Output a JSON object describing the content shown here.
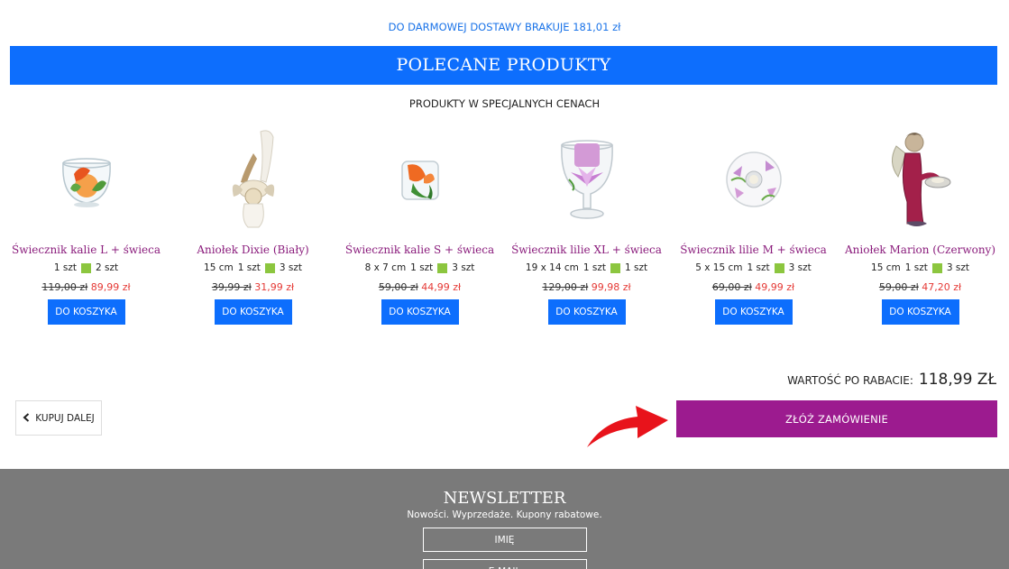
{
  "free_shipping": "DO DARMOWEJ DOSTAWY BRAKUJE 181,01 zł",
  "banner": "POLECANE PRODUKTY",
  "subtitle": "PRODUKTY W SPECJALNYCH CENACH",
  "products": [
    {
      "name": "Świecznik kalie L + świeca",
      "size": "",
      "qty_a": "1 szt",
      "qty_b": "2 szt",
      "old_price": "119,00 zł",
      "new_price": "89,99 zł",
      "button": "DO KOSZYKA"
    },
    {
      "name": "Aniołek Dixie (Biały)",
      "size": "15 cm",
      "qty_a": "1 szt",
      "qty_b": "3 szt",
      "old_price": "39,99 zł",
      "new_price": "31,99 zł",
      "button": "DO KOSZYKA"
    },
    {
      "name": "Świecznik kalie S + świeca",
      "size": "8 x 7 cm",
      "qty_a": "1 szt",
      "qty_b": "3 szt",
      "old_price": "59,00 zł",
      "new_price": "44,99 zł",
      "button": "DO KOSZYKA"
    },
    {
      "name": "Świecznik lilie XL + świeca",
      "size": "19 x 14 cm",
      "qty_a": "1 szt",
      "qty_b": "1 szt",
      "old_price": "129,00 zł",
      "new_price": "99,98 zł",
      "button": "DO KOSZYKA"
    },
    {
      "name": "Świecznik lilie M + świeca",
      "size": "5 x 15 cm",
      "qty_a": "1 szt",
      "qty_b": "3 szt",
      "old_price": "69,00 zł",
      "new_price": "49,99 zł",
      "button": "DO KOSZYKA"
    },
    {
      "name": "Aniołek Marion (Czerwony)",
      "size": "15 cm",
      "qty_a": "1 szt",
      "qty_b": "3 szt",
      "old_price": "59,00 zł",
      "new_price": "47,20 zł",
      "button": "DO KOSZYKA"
    }
  ],
  "total": {
    "label": "WARTOŚĆ PO RABACIE:",
    "value": "118,99 ZŁ"
  },
  "continue_label": "KUPUJ DALEJ",
  "order_label": "ZŁÓŻ ZAMÓWIENIE",
  "newsletter": {
    "title": "NEWSLETTER",
    "subtitle": "Nowości. Wyprzedaże. Kupony rabatowe.",
    "name_placeholder": "IMIĘ",
    "email_placeholder": "E-MAIL"
  },
  "colors": {
    "accent_blue": "#0d6efd",
    "order_purple": "#9c1b8f",
    "product_name": "#8a1c7c",
    "sale_red": "#e53935",
    "swatch_green": "#8cc63f",
    "footer_gray": "#7a7a7a"
  },
  "icons": [
    "chevron-left-icon",
    "red-curved-arrow-icon"
  ]
}
